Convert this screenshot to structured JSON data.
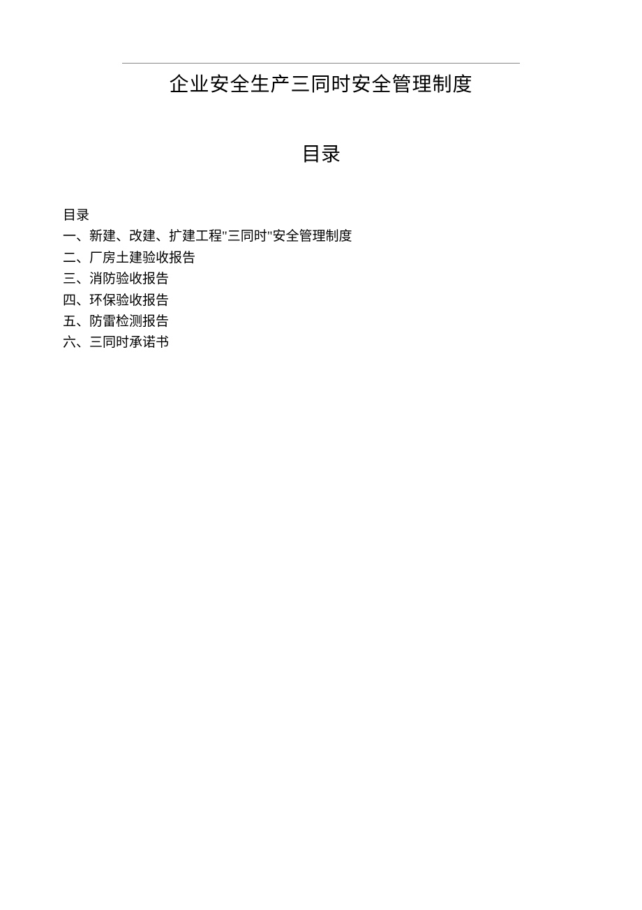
{
  "title": "企业安全生产三同时安全管理制度",
  "subtitle": "目录",
  "toc": {
    "header": "目录",
    "items": [
      "一、新建、改建、扩建工程\"三同时\"安全管理制度",
      "二、厂房土建验收报告",
      "三、消防验收报告",
      "四、环保验收报告",
      "五、防雷检测报告",
      "六、三同时承诺书"
    ]
  }
}
